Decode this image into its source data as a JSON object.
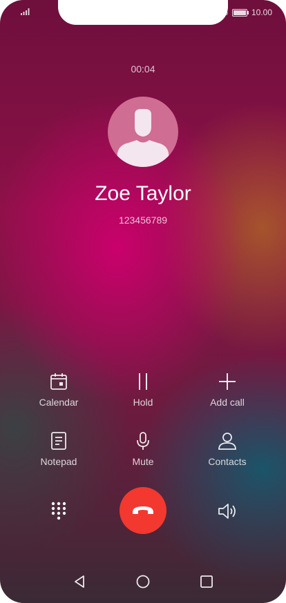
{
  "status_bar": {
    "battery_text": "100 %",
    "time": "10.00"
  },
  "call": {
    "duration": "00:04",
    "contact_name": "Zoe Taylor",
    "phone_number": "123456789"
  },
  "actions": [
    {
      "label": "Calendar",
      "icon": "calendar-icon"
    },
    {
      "label": "Hold",
      "icon": "pause-icon"
    },
    {
      "label": "Add call",
      "icon": "plus-icon"
    },
    {
      "label": "Notepad",
      "icon": "notepad-icon"
    },
    {
      "label": "Mute",
      "icon": "microphone-icon"
    },
    {
      "label": "Contacts",
      "icon": "person-icon"
    }
  ],
  "bottom_controls": {
    "dialpad_icon": "dialpad-icon",
    "end_call_icon": "hang-up-icon",
    "speaker_icon": "speaker-icon",
    "end_call_color": "#f3382f"
  },
  "nav": {
    "back_icon": "back-triangle-icon",
    "home_icon": "home-circle-icon",
    "recents_icon": "recents-square-icon"
  }
}
